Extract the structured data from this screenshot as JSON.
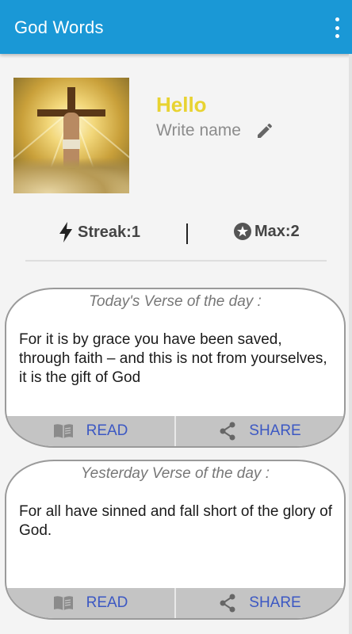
{
  "app": {
    "title": "God Words"
  },
  "profile": {
    "greeting": "Hello",
    "name_placeholder": "Write name"
  },
  "stats": {
    "streak_label": "Streak:",
    "streak_value": "1",
    "max_label": "Max:",
    "max_value": "2"
  },
  "verses": [
    {
      "header": "Today's Verse of the day :",
      "text": "For it is by grace you have been saved, through faith – and this is not from yourselves, it is the gift of God",
      "read_label": "READ",
      "share_label": "SHARE"
    },
    {
      "header": "Yesterday Verse of the day :",
      "text": "For all have sinned and fall short of the glory of God.",
      "read_label": "READ",
      "share_label": "SHARE"
    }
  ],
  "colors": {
    "primary": "#1a98d6",
    "hello": "#e8d331",
    "action": "#3c58c3"
  },
  "icons": [
    "overflow-menu-icon",
    "edit-pencil-icon",
    "lightning-icon",
    "star-circle-icon",
    "book-icon",
    "share-icon"
  ]
}
